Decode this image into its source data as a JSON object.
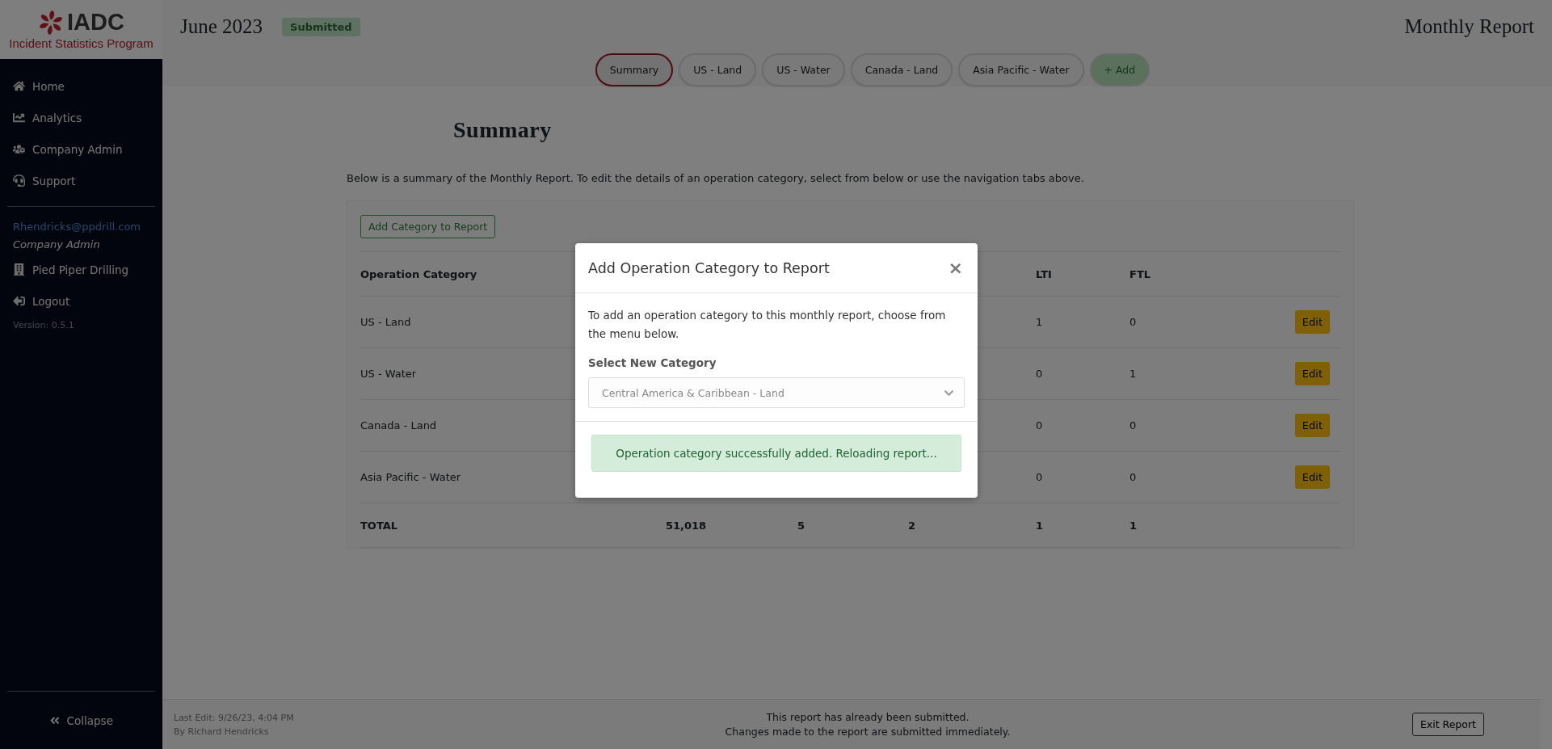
{
  "sidebar": {
    "logo": {
      "name": "IADC",
      "subtitle": "Incident Statistics Program"
    },
    "nav": [
      {
        "label": "Home"
      },
      {
        "label": "Analytics"
      },
      {
        "label": "Company Admin"
      },
      {
        "label": "Support"
      }
    ],
    "user": {
      "email": "Rhendricks@ppdrill.com",
      "role": "Company Admin",
      "company": "Pied Piper Drilling"
    },
    "logout": "Logout",
    "version": "Version: 0.5.1",
    "collapse": "Collapse"
  },
  "header": {
    "period": "June 2023",
    "status": "Submitted",
    "title": "Monthly Report"
  },
  "tabs": [
    {
      "label": "Summary",
      "kind": "tab",
      "selected": true
    },
    {
      "label": "US - Land",
      "kind": "tab",
      "selected": false
    },
    {
      "label": "US - Water",
      "kind": "tab",
      "selected": false
    },
    {
      "label": "Canada - Land",
      "kind": "tab",
      "selected": false
    },
    {
      "label": "Asia Pacific - Water",
      "kind": "tab",
      "selected": false
    },
    {
      "label": "+ Add",
      "kind": "add",
      "selected": false
    }
  ],
  "summary": {
    "title": "Summary",
    "description": "Below is a summary of the Monthly Report. To edit the details of an operation category, select from below or use the navigation tabs above.",
    "add_button": "Add Category to Report",
    "header": {
      "category": "Operation Category",
      "lti": "LTI",
      "ftl": "FTL"
    },
    "rows": [
      {
        "category": "US - Land",
        "lti": "1",
        "ftl": "0",
        "action": "Edit"
      },
      {
        "category": "US - Water",
        "lti": "0",
        "ftl": "1",
        "action": "Edit"
      },
      {
        "category": "Canada - Land",
        "lti": "0",
        "ftl": "0",
        "action": "Edit"
      },
      {
        "category": "Asia Pacific - Water",
        "lti": "0",
        "ftl": "0",
        "action": "Edit"
      }
    ],
    "total": {
      "label": "TOTAL",
      "column_2": "51,018",
      "column_3": "5",
      "column_4": "2",
      "lti": "1",
      "ftl": "1"
    }
  },
  "modal": {
    "title": "Add Operation Category to Report",
    "close": "×",
    "text": "To add an operation category to this monthly report, choose from the menu below.",
    "select_label": "Select New Category",
    "select": {
      "value": "Central America & Caribbean - Land",
      "disabled": true
    },
    "alert": "Operation category successfully added. Reloading report..."
  },
  "footer": {
    "last_edit": "Last Edit: 9/26/23, 4:04 PM",
    "by": "By Richard Hendricks",
    "notice": [
      "This report has already been submitted.",
      "Changes made to the report are submitted immediately."
    ],
    "exit_button": "Exit Report"
  }
}
